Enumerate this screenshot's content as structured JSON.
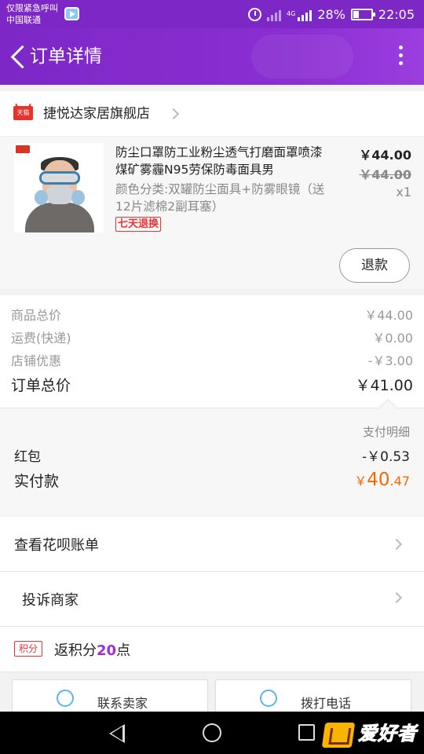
{
  "status_bar": {
    "carrier_line1": "仅限紧急呼叫",
    "carrier_line2": "中国联通",
    "network_label": "4G",
    "battery": "28%",
    "time": "22:05"
  },
  "header": {
    "title": "订单详情"
  },
  "store": {
    "name": "捷悦达家居旗舰店",
    "badge": "天猫"
  },
  "product": {
    "title": "防尘口罩防工业粉尘透气打磨面罩喷漆煤矿雾霾N95劳保防毒面具男",
    "spec": "颜色分类:双罐防尘面具+防雾眼镜（送12片滤棉2副耳塞）",
    "return_badge": "七天退换",
    "price": "￥44.00",
    "original_price": "￥44.00",
    "quantity": "x1",
    "refund_button": "退款"
  },
  "summary": {
    "rows": [
      {
        "label": "商品总价",
        "value": "￥44.00"
      },
      {
        "label": "运费(快递)",
        "value": "￥0.00"
      },
      {
        "label": "店铺优惠",
        "value": "-￥3.00"
      }
    ],
    "total_label": "订单总价",
    "total_value": "￥41.00"
  },
  "payment": {
    "detail_label": "支付明细",
    "red_packet_label": "红包",
    "red_packet_value": "-￥0.53",
    "actual_label": "实付款",
    "actual_symbol": "￥",
    "actual_integer": "40",
    "actual_decimal": ".47",
    "accent_color": "#f26a00"
  },
  "menu": {
    "huabei": "查看花呗账单",
    "complain": "投诉商家"
  },
  "points": {
    "badge": "积分",
    "text_prefix": "返积分",
    "amount": "20",
    "text_suffix": "点"
  },
  "bottom_actions": {
    "contact_seller": "联系卖家",
    "call": "拨打电话"
  },
  "watermark": {
    "text": "爱好者"
  },
  "colors": {
    "brand_purple": "#7d27c7",
    "accent_red": "#e33333"
  }
}
